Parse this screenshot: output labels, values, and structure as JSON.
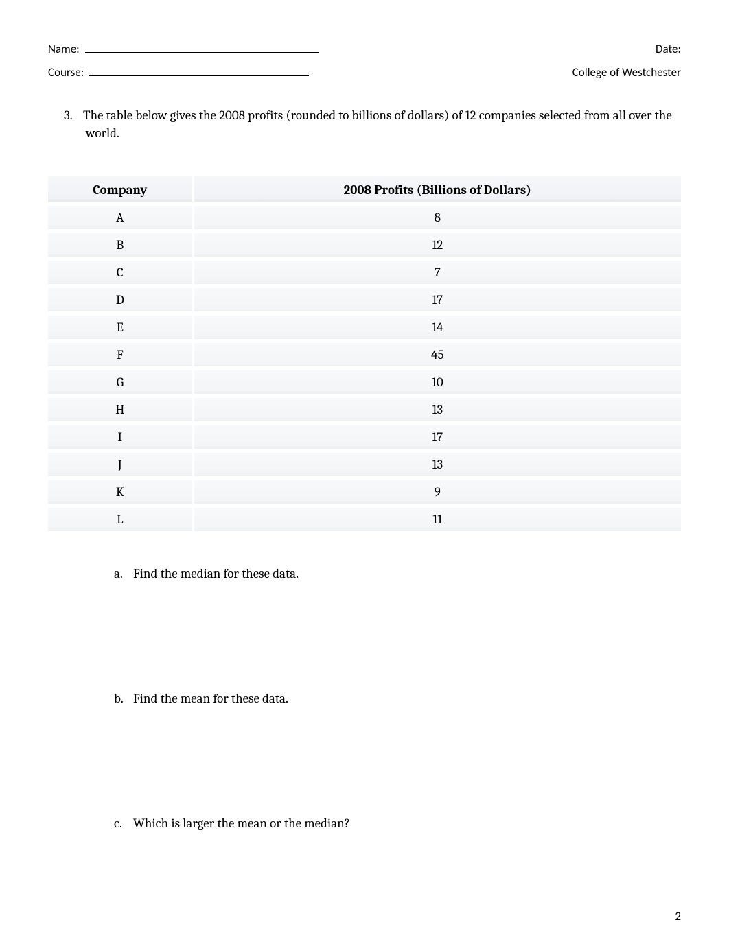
{
  "header": {
    "name_label": "Name:",
    "date_label": "Date:",
    "course_label": "Course:",
    "institution": "College of Westchester"
  },
  "question": {
    "number": "3.",
    "text": "The table below gives the 2008 profits (rounded to billions of dollars) of 12 companies selected from all over the world."
  },
  "table": {
    "headers": {
      "col1": "Company",
      "col2": "2008 Profits (Billions of Dollars)"
    },
    "rows": [
      {
        "company": "A",
        "profit": "8"
      },
      {
        "company": "B",
        "profit": "12"
      },
      {
        "company": "C",
        "profit": "7"
      },
      {
        "company": "D",
        "profit": "17"
      },
      {
        "company": "E",
        "profit": "14"
      },
      {
        "company": "F",
        "profit": "45"
      },
      {
        "company": "G",
        "profit": "10"
      },
      {
        "company": "H",
        "profit": "13"
      },
      {
        "company": "I",
        "profit": "17"
      },
      {
        "company": "J",
        "profit": "13"
      },
      {
        "company": "K",
        "profit": "9"
      },
      {
        "company": "L",
        "profit": "11"
      }
    ]
  },
  "sub_questions": {
    "a": {
      "letter": "a.",
      "text": "Find the median for these data."
    },
    "b": {
      "letter": "b.",
      "text": "Find the mean for these data."
    },
    "c": {
      "letter": "c.",
      "text": "Which is larger the mean or the median?"
    }
  },
  "page_number": "2"
}
